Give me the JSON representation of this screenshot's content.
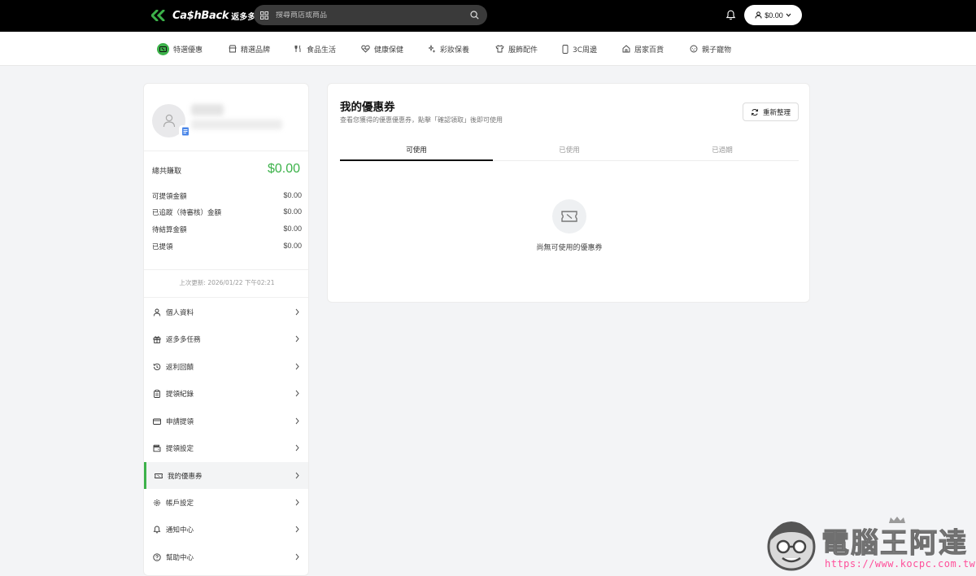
{
  "header": {
    "logo_text": "Ca$hBack",
    "logo_sub": "返多多",
    "search_placeholder": "搜尋商店或商品",
    "wallet_amount": "$0.00"
  },
  "categories": [
    {
      "label": "特選優惠",
      "icon": "special-offer-icon"
    },
    {
      "label": "精選品牌",
      "icon": "store-icon"
    },
    {
      "label": "食品生活",
      "icon": "utensils-icon"
    },
    {
      "label": "健康保健",
      "icon": "heart-pulse-icon"
    },
    {
      "label": "彩妝保養",
      "icon": "sparkles-icon"
    },
    {
      "label": "服飾配件",
      "icon": "shirt-icon"
    },
    {
      "label": "3C周邊",
      "icon": "phone-icon"
    },
    {
      "label": "居家百貨",
      "icon": "home-icon"
    },
    {
      "label": "親子寵物",
      "icon": "baby-icon"
    }
  ],
  "sidebar": {
    "total_label": "總共賺取",
    "total_value": "$0.00",
    "amounts": [
      {
        "label": "可提領金額",
        "value": "$0.00"
      },
      {
        "label": "已追蹤（待審核）金額",
        "value": "$0.00"
      },
      {
        "label": "待結算金額",
        "value": "$0.00"
      },
      {
        "label": "已提領",
        "value": "$0.00"
      }
    ],
    "updated": "上次更新: 2026/01/22 下午02:21",
    "menu": [
      {
        "label": "個人資料",
        "icon": "user-icon"
      },
      {
        "label": "返多多任務",
        "icon": "gift-icon"
      },
      {
        "label": "返利回饋",
        "icon": "history-icon"
      },
      {
        "label": "提領紀錄",
        "icon": "clipboard-icon"
      },
      {
        "label": "申請提領",
        "icon": "credit-card-icon"
      },
      {
        "label": "提領設定",
        "icon": "wallet-icon"
      },
      {
        "label": "我的優惠券",
        "icon": "ticket-icon"
      },
      {
        "label": "帳戶設定",
        "icon": "gear-icon"
      },
      {
        "label": "通知中心",
        "icon": "bell-icon"
      },
      {
        "label": "幫助中心",
        "icon": "help-icon"
      }
    ]
  },
  "main": {
    "title": "我的優惠券",
    "subtitle": "查看您獲得的優惠優惠券，點擊「確認領取」後即可使用",
    "refresh_label": "重新整理",
    "tabs": [
      "可使用",
      "已使用",
      "已過期"
    ],
    "empty_text": "尚無可使用的優惠券"
  },
  "watermark": {
    "title": "電腦王阿達",
    "url": "https://www.kocpc.com.tw/"
  },
  "colors": {
    "brand_green": "#3cb24a",
    "topbar": "#000000",
    "watermark_url": "#ff4f9a"
  }
}
